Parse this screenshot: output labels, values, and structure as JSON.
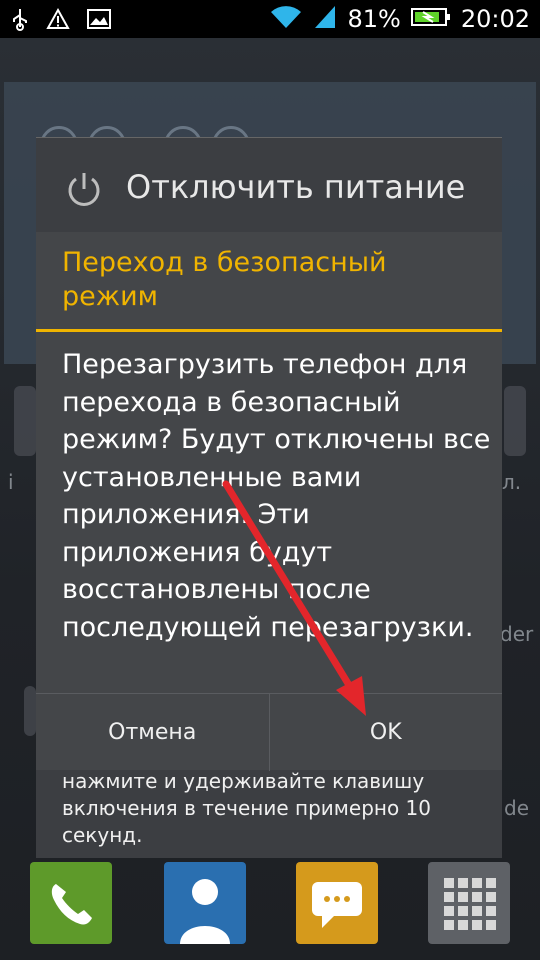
{
  "status_bar": {
    "battery_percent": "81%",
    "time": "20:02",
    "icons": [
      "usb-icon",
      "warning-icon",
      "image-icon",
      "wifi-icon",
      "signal-icon",
      "battery-charging-icon"
    ]
  },
  "power_menu": {
    "title": "Отключить питание",
    "hint": "нажмите и удерживайте клавишу включения в течение примерно 10 секунд."
  },
  "dialog": {
    "title": "Переход в безопасный режим",
    "message": "Перезагрузить телефон для перехода в безопасный режим? Будут отключены все установленные вами приложения. Эти приложения будут восстановлены после последующей перезагрузки.",
    "cancel_label": "Отмена",
    "ok_label": "OK"
  },
  "background": {
    "side_labels": [
      "i",
      "л.",
      "der",
      "de"
    ]
  },
  "colors": {
    "accent": "#f0b400",
    "dialog_bg": "#444649",
    "arrow": "#e3262b"
  }
}
